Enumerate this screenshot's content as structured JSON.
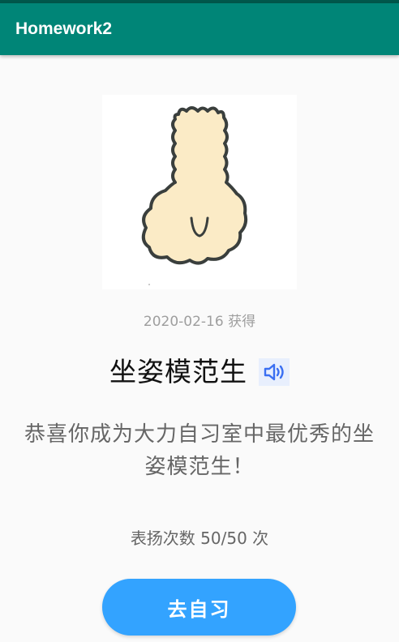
{
  "app_bar": {
    "title": "Homework2"
  },
  "badge": {
    "image_icon": "alpaca-back-illustration",
    "date_text": "2020-02-16 获得",
    "title": "坐姿模范生",
    "speaker_icon": "speaker-sound-icon",
    "description": "恭喜你成为大力自习室中最优秀的坐姿模范生！",
    "praise_text": "表扬次数 50/50 次",
    "action_label": "去自习"
  },
  "colors": {
    "status_bar": "#00574b",
    "app_bar": "#008577",
    "background": "#fafafa",
    "button": "#33a3ff",
    "speaker_bg": "#e8effd",
    "speaker_icon": "#3a6ff2",
    "muted_text": "#9e9e9e",
    "body_text": "#666666"
  }
}
